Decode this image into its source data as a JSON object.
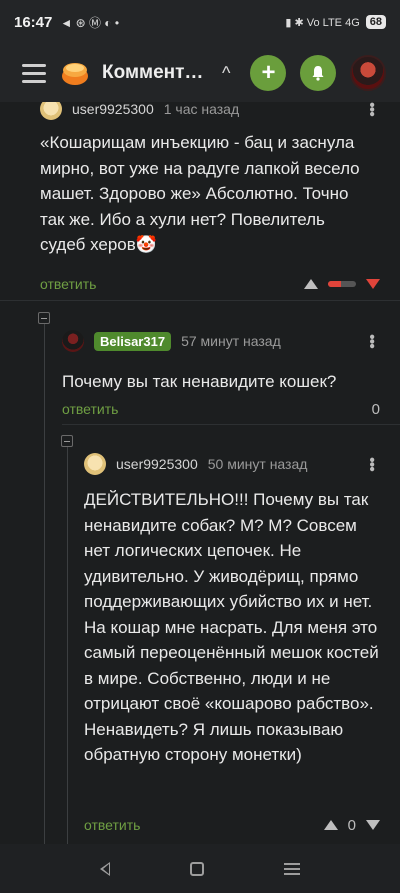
{
  "status": {
    "time": "16:47",
    "left_icons": "◄ ⊛ Ⓜ ◐ •",
    "right_icons": "▮ ✱ Vo LTE 4G",
    "battery": "68"
  },
  "appbar": {
    "title": "Коммент…",
    "chevron": "^",
    "add_label": "+",
    "bell_label": "🔔"
  },
  "comments": [
    {
      "user": "user9925300",
      "time": "1 час назад",
      "text": "«Кошарищам инъекцию - бац и заснула мирно, вот уже на радуге лапкой весело машет. Здорово же» Абсолютно. Точно так же. Ибо а хули нет? Повелитель судеб херов🤡",
      "reply": "ответить",
      "score": "",
      "ratio": 0.45
    },
    {
      "user": "Belisar317",
      "time": "57 минут назад",
      "text": "Почему вы так ненавидите кошек?",
      "reply": "ответить",
      "score": "0"
    },
    {
      "user": "user9925300",
      "time": "50 минут назад",
      "text": "ДЕЙСТВИТЕЛЬНО!!! Почему вы так ненавидите собак? М? М? Совсем нет логических цепочек. Не удивительно. У живодёрищ, прямо поддерживающих убийство их и нет. На кошар мне насрать. Для меня это самый переоценённый мешок костей в мире. Собственно, люди и не отрицают своё «кошарово рабство». Ненавидеть? Я лишь показываю обратную сторону монетки)",
      "reply": "ответить",
      "score": "0"
    }
  ],
  "colors": {
    "accent_green": "#6a9e3c",
    "reply_green": "#6f9f43",
    "downvote_red": "#e0443a"
  }
}
